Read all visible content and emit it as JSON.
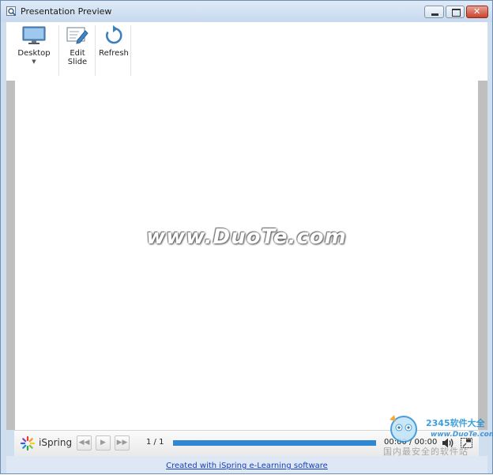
{
  "window": {
    "title": "Presentation Preview"
  },
  "ribbon": {
    "desktop_label": "Desktop",
    "edit_slide_label": [
      "Edit",
      "Slide"
    ],
    "refresh_label": "Refresh"
  },
  "slide": {
    "watermark_text": "www.DuoTe.com"
  },
  "player": {
    "brand": "iSpring",
    "page_counter": "1 / 1",
    "progress": 1.0,
    "time": "00:00 / 00:00",
    "progress_color": "#2f86d1"
  },
  "footer": {
    "credit": "Created with iSpring e-Learning software"
  },
  "corner_logo": {
    "text": "2345软件大全",
    "site": "www.DuoTe.com",
    "caption": "国内最安全的软件站"
  },
  "icons": [
    "search-icon",
    "minimize-icon",
    "maximize-icon",
    "close-icon",
    "monitor-icon",
    "dropdown-arrow-icon",
    "edit-slide-icon",
    "refresh-icon",
    "ispring-logo-icon",
    "rewind-icon",
    "play-icon",
    "fast-forward-icon",
    "volume-icon",
    "fullscreen-icon"
  ]
}
